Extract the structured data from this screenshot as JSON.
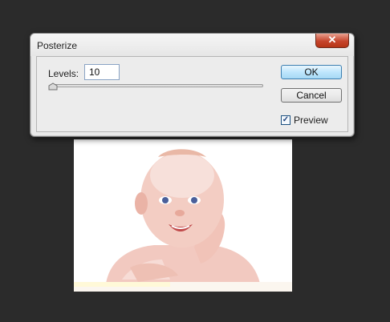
{
  "dialog": {
    "title": "Posterize",
    "close_glyph": "✕",
    "levels_label": "Levels:",
    "levels_value": "10",
    "slider_fraction": 0.0,
    "ok_label": "OK",
    "cancel_label": "Cancel",
    "preview_checked": true,
    "preview_check_glyph": "✓",
    "preview_label": "Preview"
  },
  "canvas": {
    "icon": "baby-photo"
  },
  "colors": {
    "workspace_bg": "#2b2b2b",
    "dialog_bg": "#e9e9e9",
    "close_button": "#c6452c",
    "ok_button": "#bee6fd"
  }
}
